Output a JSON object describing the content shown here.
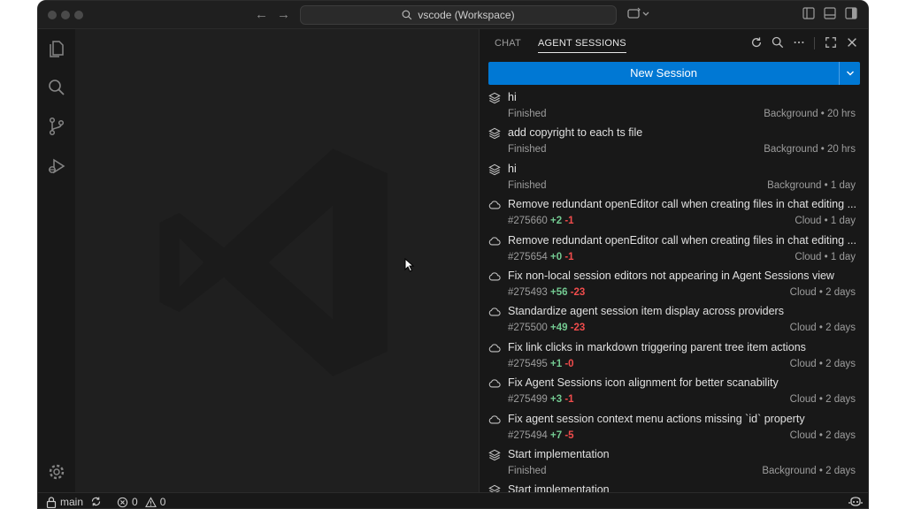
{
  "titlebar": {
    "command_center": "vscode (Workspace)"
  },
  "panel": {
    "tabs": [
      {
        "label": "CHAT"
      },
      {
        "label": "AGENT SESSIONS"
      }
    ],
    "new_session_label": "New Session"
  },
  "sessions": [
    {
      "icon": "stack-icon",
      "title": "hi",
      "status": "Finished",
      "meta": "Background • 20 hrs"
    },
    {
      "icon": "stack-icon",
      "title": "add copyright to each ts file",
      "status": "Finished",
      "meta": "Background • 20 hrs"
    },
    {
      "icon": "stack-icon",
      "title": "hi",
      "status": "Finished",
      "meta": "Background • 1 day"
    },
    {
      "icon": "cloud-icon",
      "title": "Remove redundant openEditor call when creating files in chat editing ...",
      "pr": "#275660",
      "added": "+2",
      "removed": "-1",
      "meta": "Cloud • 1 day"
    },
    {
      "icon": "cloud-icon",
      "title": "Remove redundant openEditor call when creating files in chat editing ...",
      "pr": "#275654",
      "added": "+0",
      "removed": "-1",
      "meta": "Cloud • 1 day"
    },
    {
      "icon": "cloud-icon",
      "title": "Fix non-local session editors not appearing in Agent Sessions view",
      "pr": "#275493",
      "added": "+56",
      "removed": "-23",
      "meta": "Cloud • 2 days"
    },
    {
      "icon": "cloud-icon",
      "title": "Standardize agent session item display across providers",
      "pr": "#275500",
      "added": "+49",
      "removed": "-23",
      "meta": "Cloud • 2 days"
    },
    {
      "icon": "cloud-icon",
      "title": "Fix link clicks in markdown triggering parent tree item actions",
      "pr": "#275495",
      "added": "+1",
      "removed": "-0",
      "meta": "Cloud • 2 days"
    },
    {
      "icon": "cloud-icon",
      "title": "Fix Agent Sessions icon alignment for better scanability",
      "pr": "#275499",
      "added": "+3",
      "removed": "-1",
      "meta": "Cloud • 2 days"
    },
    {
      "icon": "cloud-icon",
      "title": "Fix agent session context menu actions missing `id` property",
      "pr": "#275494",
      "added": "+7",
      "removed": "-5",
      "meta": "Cloud • 2 days"
    },
    {
      "icon": "stack-icon",
      "title": "Start implementation",
      "status": "Finished",
      "meta": "Background • 2 days"
    },
    {
      "icon": "stack-icon",
      "title": "Start implementation",
      "status": "",
      "meta": ""
    }
  ],
  "statusbar": {
    "branch": "main",
    "errors": "0",
    "warnings": "0"
  },
  "colors": {
    "accent": "#0078d4",
    "added": "#73c991",
    "removed": "#f14c4c"
  }
}
